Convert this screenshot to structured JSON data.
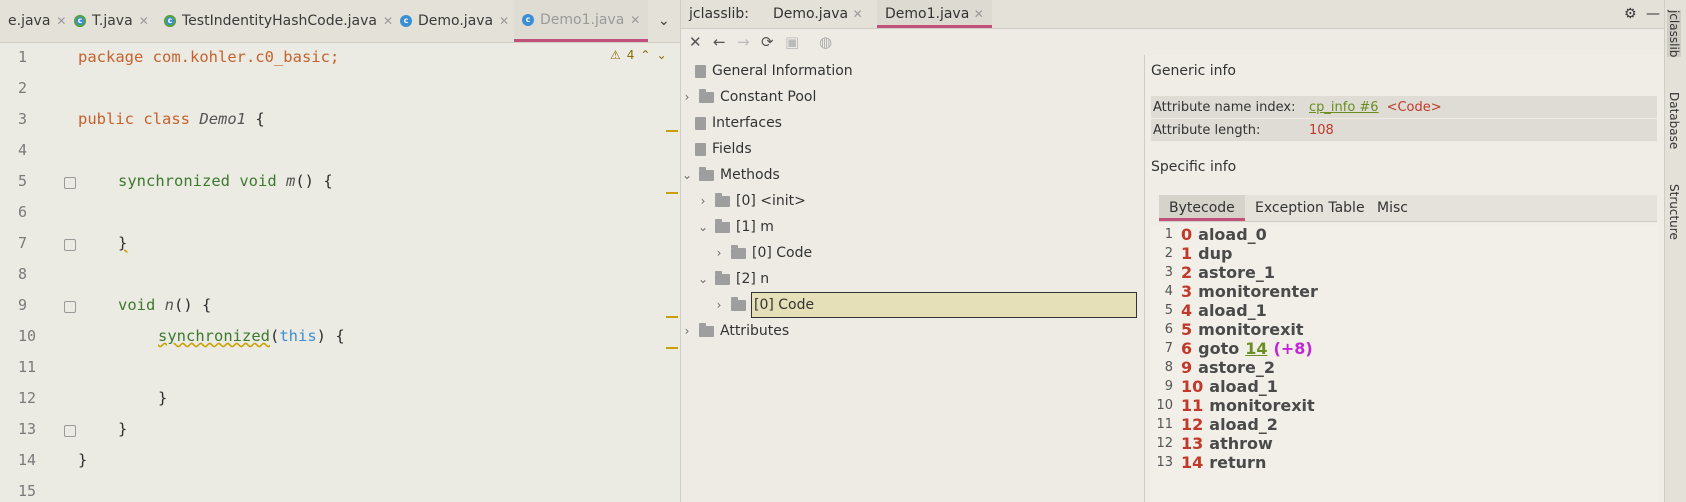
{
  "editor": {
    "tabs": [
      {
        "label": "e.java",
        "icon": "none"
      },
      {
        "label": "T.java",
        "icon": "class-icon"
      },
      {
        "label": "TestIndentityHashCode.java",
        "icon": "class-icon"
      },
      {
        "label": "Demo.java",
        "icon": "class-icon"
      },
      {
        "label": "Demo1.java",
        "icon": "class-icon",
        "active": true
      }
    ],
    "tab_menu_icon": "chevron-down-icon",
    "warning_count": "4",
    "line_numbers": [
      "1",
      "2",
      "3",
      "4",
      "5",
      "6",
      "7",
      "8",
      "9",
      "10",
      "11",
      "12",
      "13",
      "14",
      "15"
    ],
    "code": {
      "line1_kw": "package",
      "line1_rest": " com.kohler.c0_basic;",
      "line3_kw1": "public",
      "line3_kw2": "class",
      "line3_name": "Demo1",
      "line3_rest": " {",
      "line5_kw1": "synchronized",
      "line5_kw2": "void",
      "line5_name": "m",
      "line5_rest": "() {",
      "line7": "}",
      "line9_kw": "void",
      "line9_name": "n",
      "line9_rest": "() {",
      "line10_kw": "synchronized",
      "line10_open": "(",
      "line10_this": "this",
      "line10_rest": ") {",
      "line12": "}",
      "line13": "}",
      "line14": "}"
    }
  },
  "jclasslib": {
    "title": "jclasslib:",
    "tabs": [
      "Demo.java",
      "Demo1.java"
    ],
    "tree": {
      "general_information": "General Information",
      "constant_pool": "Constant Pool",
      "interfaces": "Interfaces",
      "fields": "Fields",
      "methods": "Methods",
      "method_init": "[0] <init>",
      "method_m": "[1] m",
      "method_m_code": "[0] Code",
      "method_n": "[2] n",
      "method_n_code": "[0] Code",
      "attributes": "Attributes"
    },
    "generic_info": {
      "title": "Generic info",
      "attr_name_index_label": "Attribute name index:",
      "attr_name_index_link": "cp_info #6",
      "attr_name_index_value": "<Code>",
      "attr_length_label": "Attribute length:",
      "attr_length_value": "108"
    },
    "specific_info": {
      "title": "Specific info",
      "tabs": [
        "Bytecode",
        "Exception Table",
        "Misc"
      ]
    },
    "bytecode": [
      {
        "ln": "1",
        "off": "0",
        "op": "aload_0"
      },
      {
        "ln": "2",
        "off": "1",
        "op": "dup"
      },
      {
        "ln": "3",
        "off": "2",
        "op": "astore_1"
      },
      {
        "ln": "4",
        "off": "3",
        "op": "monitorenter"
      },
      {
        "ln": "5",
        "off": "4",
        "op": "aload_1"
      },
      {
        "ln": "6",
        "off": "5",
        "op": "monitorexit"
      },
      {
        "ln": "7",
        "off": "6",
        "op": "goto",
        "target": "14",
        "extra": "(+8)"
      },
      {
        "ln": "8",
        "off": "9",
        "op": "astore_2"
      },
      {
        "ln": "9",
        "off": "10",
        "op": "aload_1"
      },
      {
        "ln": "10",
        "off": "11",
        "op": "monitorexit"
      },
      {
        "ln": "11",
        "off": "12",
        "op": "aload_2"
      },
      {
        "ln": "12",
        "off": "13",
        "op": "athrow"
      },
      {
        "ln": "13",
        "off": "14",
        "op": "return"
      }
    ]
  },
  "side_stripe": [
    "jclasslib",
    "Database",
    "Structure"
  ],
  "colors": {
    "accent": "#c0517b",
    "keyword": "#c4622d",
    "offset": "#c0392b",
    "link": "#6a8e22",
    "magenta": "#c026d3"
  }
}
